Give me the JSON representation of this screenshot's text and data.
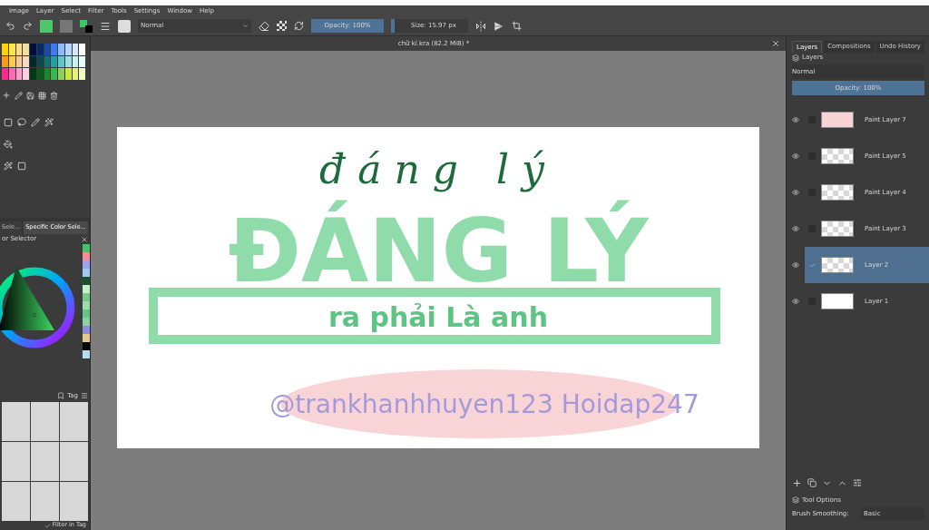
{
  "menu": [
    "Image",
    "Layer",
    "Select",
    "Filter",
    "Tools",
    "Settings",
    "Window",
    "Help"
  ],
  "toolbar": {
    "blend_mode": "Normal",
    "opacity": {
      "label": "Opacity: 100%",
      "level": 1
    },
    "size": {
      "label": "Size: 15.97 px",
      "level": 0.05
    }
  },
  "document": {
    "title": "chữ kí.kra (82.2 MiB) *",
    "artwork": {
      "outline_word": "ĐÁNG LÝ",
      "script_word": "đáng lý",
      "banner_text": "ra phải Là anh",
      "signature": "@trankhanhhuyen123 Hoidap247"
    }
  },
  "left_panel": {
    "tabs": [
      {
        "label": "Sele...",
        "selected": false
      },
      {
        "label": "Specific Color Sele...",
        "selected": true
      }
    ],
    "color_selector_title": "or Selector",
    "brush_tag": "Tag",
    "filter_in_tag": {
      "label": "Filter in Tag",
      "checked": true
    }
  },
  "right_panel": {
    "tabs": [
      {
        "label": "Layers",
        "selected": true
      },
      {
        "label": "Compositions",
        "selected": false
      },
      {
        "label": "Undo History",
        "selected": false
      }
    ],
    "docker_title": "Layers",
    "blend_mode": "Normal",
    "opacity": {
      "label": "Opacity: 100%",
      "level": 1
    },
    "layers": [
      {
        "name": "Paint Layer 7",
        "visible": true,
        "selected": false,
        "checked": false,
        "kind": "pink"
      },
      {
        "name": "Paint Layer 5",
        "visible": true,
        "selected": false,
        "checked": false,
        "kind": "checker"
      },
      {
        "name": "Paint Layer 4",
        "visible": true,
        "selected": false,
        "checked": false,
        "kind": "checker"
      },
      {
        "name": "Paint Layer 3",
        "visible": true,
        "selected": false,
        "checked": false,
        "kind": "checker"
      },
      {
        "name": "Layer 2",
        "visible": true,
        "selected": true,
        "checked": true,
        "kind": "checker"
      },
      {
        "name": "Layer 1",
        "visible": true,
        "selected": false,
        "checked": false,
        "kind": "white"
      }
    ],
    "tool_options_title": "Tool Options",
    "brush_smoothing_label": "Brush Smoothing:",
    "brush_smoothing_value": "Basic"
  }
}
